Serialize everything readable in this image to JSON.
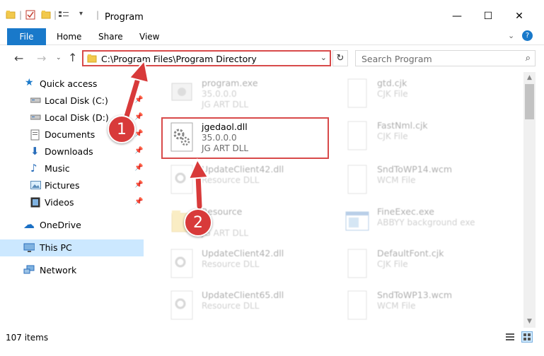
{
  "window": {
    "title": "Program",
    "minimize": "—",
    "maximize": "☐",
    "close": "✕"
  },
  "ribbon": {
    "file": "File",
    "home": "Home",
    "share": "Share",
    "view": "View",
    "help": "?"
  },
  "address": {
    "path": "C:\\Program Files\\Program Directory"
  },
  "search": {
    "placeholder": "Search Program"
  },
  "nav": {
    "quick_access": "Quick access",
    "local_c": "Local Disk (C:)",
    "local_d": "Local Disk (D:)",
    "documents": "Documents",
    "downloads": "Downloads",
    "music": "Music",
    "pictures": "Pictures",
    "videos": "Videos",
    "onedrive": "OneDrive",
    "this_pc": "This PC",
    "network": "Network"
  },
  "files": {
    "left": [
      {
        "name": "program.exe",
        "sub1": "35.0.0.0",
        "sub2": "JG ART DLL"
      },
      {
        "name": "jgedaol.dll",
        "sub1": "35.0.0.0",
        "sub2": "JG ART DLL"
      },
      {
        "name": "UpdateClient42.dll",
        "sub1": "Resource DLL",
        "sub2": ""
      },
      {
        "name": "Resource",
        "sub1": "",
        "sub2": "JG ART DLL"
      },
      {
        "name": "UpdateClient42.dll",
        "sub1": "Resource DLL",
        "sub2": ""
      },
      {
        "name": "UpdateClient65.dll",
        "sub1": "Resource DLL",
        "sub2": ""
      }
    ],
    "right": [
      {
        "name": "gtd.cjk",
        "sub1": "CJK File"
      },
      {
        "name": "FastNml.cjk",
        "sub1": "CJK File"
      },
      {
        "name": "SndToWP14.wcm",
        "sub1": "WCM File"
      },
      {
        "name": "FineExec.exe",
        "sub1": "ABBYY background exe"
      },
      {
        "name": "DefaultFont.cjk",
        "sub1": "CJK File"
      },
      {
        "name": "SndToWP13.wcm",
        "sub1": "WCM File"
      }
    ]
  },
  "status": {
    "count": "107 items"
  },
  "callouts": {
    "one": "1",
    "two": "2"
  },
  "colors": {
    "accent": "#1979ca",
    "highlight": "#d84a4a",
    "selected": "#cce8ff"
  }
}
